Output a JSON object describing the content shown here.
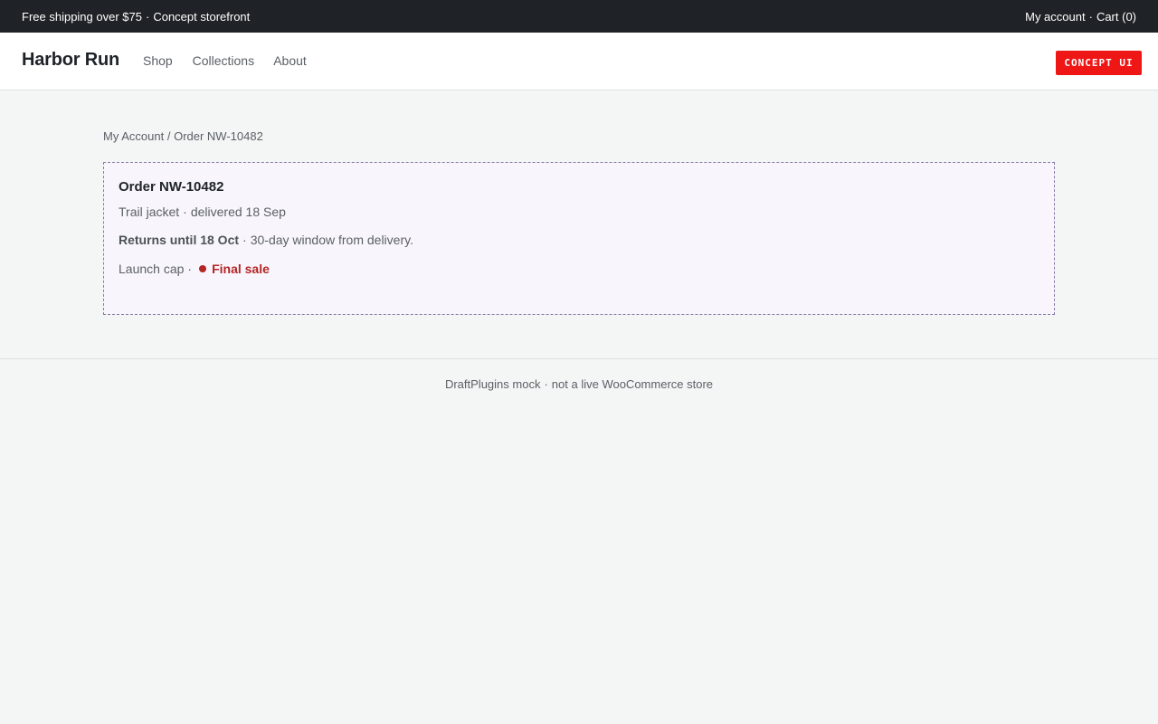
{
  "topbar": {
    "promo": "Free shipping over $75",
    "separator": "·",
    "tagline": "Concept storefront",
    "account_link": "My account",
    "cart_link": "Cart (0)"
  },
  "header": {
    "brand": "Harbor Run",
    "nav": [
      "Shop",
      "Collections",
      "About"
    ],
    "badge": "CONCEPT UI"
  },
  "breadcrumb": {
    "parent": "My Account",
    "divider": "/",
    "current": "Order NW-10482"
  },
  "order": {
    "title": "Order NW-10482",
    "item1_name": "Trail jacket",
    "item1_status": "delivered 18 Sep",
    "returns_label": "Returns until 18 Oct",
    "returns_note": "30-day window from delivery.",
    "item2_name": "Launch cap",
    "item2_status": "Final sale"
  },
  "footer": {
    "text_a": "DraftPlugins mock",
    "text_b": "not a live WooCommerce store"
  },
  "colors": {
    "topbar_bg": "#1f2226",
    "badge_bg": "#ef1616",
    "final_sale": "#b32626",
    "card_border": "#8a7aa6"
  }
}
